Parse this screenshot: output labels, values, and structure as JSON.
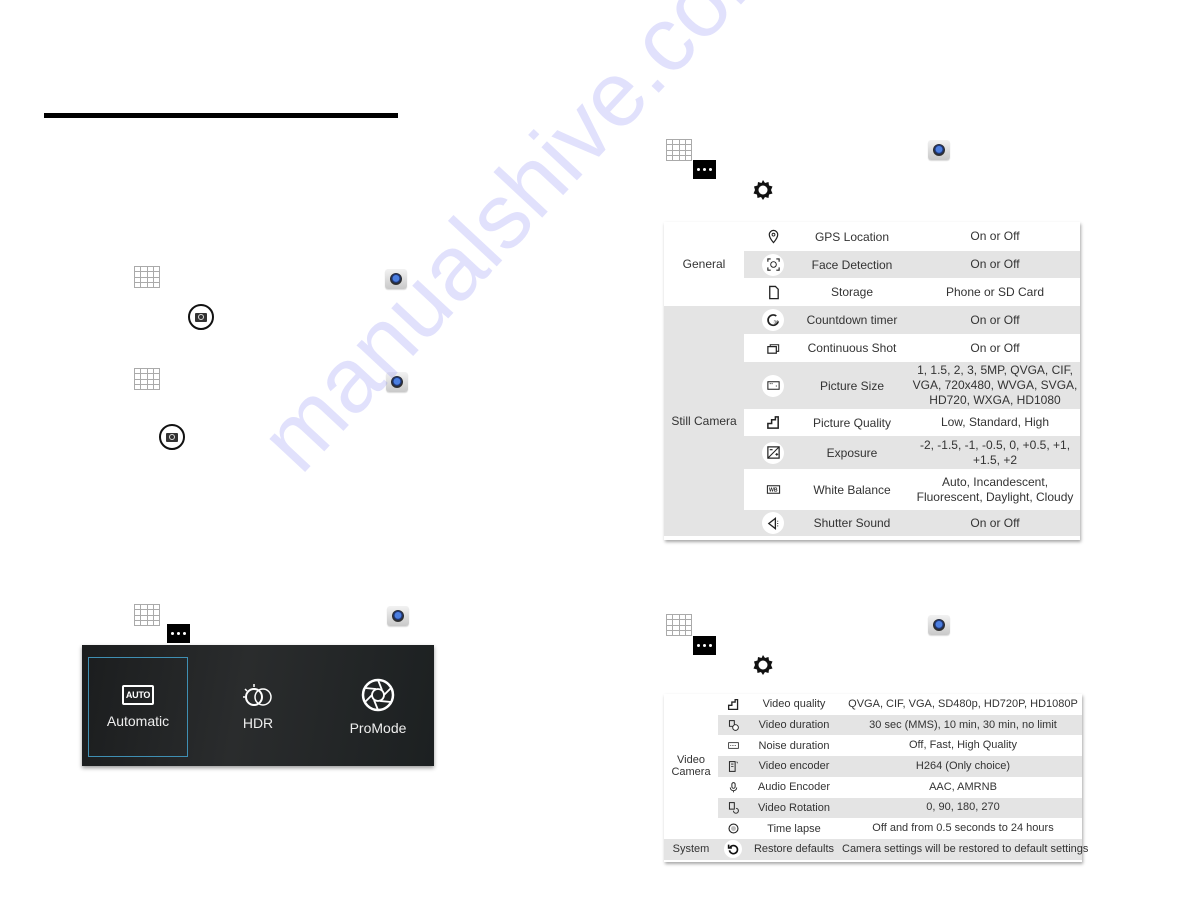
{
  "left_page": {
    "steps": [
      {
        "icons": [
          "apps-grid-icon",
          "camera-app-icon",
          "shutter-button-icon"
        ]
      },
      {
        "icons": [
          "apps-grid-icon",
          "camera-app-icon",
          "shutter-button-icon"
        ]
      },
      {
        "icons": [
          "apps-grid-icon",
          "more-options-icon",
          "camera-app-icon"
        ]
      }
    ],
    "mode_selector": {
      "modes": [
        {
          "label": "Automatic",
          "icon": "auto-icon",
          "badge": "AUTO",
          "selected": true
        },
        {
          "label": "HDR",
          "icon": "hdr-icon",
          "selected": false
        },
        {
          "label": "ProMode",
          "icon": "aperture-icon",
          "selected": false
        }
      ],
      "accent_color": "#3f8fb3"
    }
  },
  "still_table": {
    "groups": [
      {
        "name": "General",
        "rows": [
          {
            "icon": "location-pin-icon",
            "name": "GPS Location",
            "value": "On or Off"
          },
          {
            "icon": "face-detection-icon",
            "name": "Face Detection",
            "value": "On or Off"
          },
          {
            "icon": "sd-card-icon",
            "name": "Storage",
            "value": "Phone or SD Card"
          }
        ]
      },
      {
        "name": "Still Camera",
        "rows": [
          {
            "icon": "countdown-timer-icon",
            "name": "Countdown timer",
            "value": "On or Off"
          },
          {
            "icon": "continuous-shot-icon",
            "name": "Continuous Shot",
            "value": "On or Off"
          },
          {
            "icon": "picture-size-icon",
            "name": "Picture Size",
            "value": "1, 1.5, 2, 3, 5MP, QVGA, CIF, VGA, 720x480, WVGA, SVGA, HD720, WXGA, HD1080"
          },
          {
            "icon": "picture-quality-icon",
            "name": "Picture Quality",
            "value": "Low, Standard, High"
          },
          {
            "icon": "exposure-icon",
            "name": "Exposure",
            "value": "-2, -1.5, -1, -0.5, 0, +0.5, +1, +1.5, +2"
          },
          {
            "icon": "white-balance-icon",
            "name": "White Balance",
            "value": "Auto, Incandescent, Fluorescent, Daylight, Cloudy"
          },
          {
            "icon": "shutter-sound-icon",
            "name": "Shutter Sound",
            "value": "On or Off"
          }
        ]
      }
    ]
  },
  "video_table": {
    "groups": [
      {
        "name": "Video Camera",
        "rows": [
          {
            "icon": "video-quality-icon",
            "name": "Video quality",
            "value": "QVGA, CIF, VGA, SD480p, HD720P, HD1080P"
          },
          {
            "icon": "video-duration-icon",
            "name": "Video duration",
            "value": "30 sec (MMS), 10 min, 30 min, no limit"
          },
          {
            "icon": "noise-reduction-icon",
            "name": "Noise duration",
            "value": "Off, Fast, High Quality"
          },
          {
            "icon": "video-encoder-icon",
            "name": "Video encoder",
            "value": "H264 (Only choice)"
          },
          {
            "icon": "audio-encoder-icon",
            "name": "Audio Encoder",
            "value": "AAC, AMRNB"
          },
          {
            "icon": "video-rotation-icon",
            "name": "Video Rotation",
            "value": "0, 90, 180, 270"
          },
          {
            "icon": "time-lapse-icon",
            "name": "Time lapse",
            "value": "Off and from 0.5 seconds to 24 hours"
          }
        ]
      },
      {
        "name": "System",
        "rows": [
          {
            "icon": "restore-icon",
            "name": "Restore defaults",
            "value": "Camera settings will be restored to default settings"
          }
        ]
      }
    ]
  },
  "watermark": "manualshive.com"
}
